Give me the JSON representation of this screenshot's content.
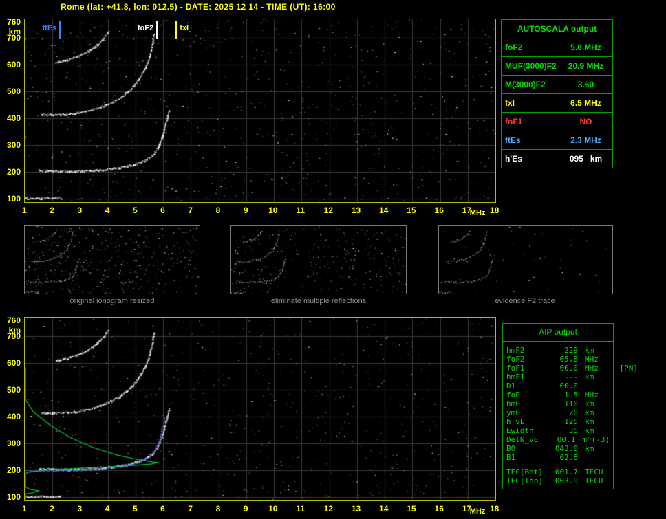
{
  "header": {
    "title": "Rome (lat: +41.8, lon: 012.5) - DATE: 2025 12 14 - TIME (UT): 16:00"
  },
  "autoscala": {
    "title": "AUTOSCALA output",
    "rows": [
      {
        "label": "foF2",
        "value": "5.8 MHz",
        "color": "#00dd00"
      },
      {
        "label": "MUF(3000)F2",
        "value": "20.9 MHz",
        "color": "#00dd00"
      },
      {
        "label": "M(3000)F2",
        "value": "3.60",
        "color": "#00dd00"
      },
      {
        "label": "fxI",
        "value": "6.5 MHz",
        "color": "#ffff00"
      },
      {
        "label": "foF1",
        "value": "NO",
        "color": "#ff3333"
      },
      {
        "label": "ftEs",
        "value": "2.3 MHz",
        "color": "#44aaff"
      },
      {
        "label": "h'Es",
        "value": "095   km",
        "color": "#ffffff"
      }
    ]
  },
  "thumbnails": [
    {
      "caption": "original ionogram resized",
      "noise_count": 520
    },
    {
      "caption": "eliminate multiple reflections",
      "noise_count": 330
    },
    {
      "caption": "evidence F2 trace",
      "noise_count": 70
    }
  ],
  "aip": {
    "title": "AIP output",
    "rows": [
      {
        "label": "hmF2",
        "value": "229",
        "unit": "km"
      },
      {
        "label": "foF2",
        "value": "05.8",
        "unit": "MHz"
      },
      {
        "label": "foF1",
        "value": "00.0",
        "unit": "MHz",
        "note": "[PN]"
      },
      {
        "label": "hmF1",
        "value": "---",
        "unit": "km"
      },
      {
        "label": "D1",
        "value": "00.0",
        "unit": ""
      },
      {
        "label": "foE",
        "value": "1.5",
        "unit": "MHz"
      },
      {
        "label": "hmE",
        "value": "110",
        "unit": "km"
      },
      {
        "label": "ymE",
        "value": "20",
        "unit": "km"
      },
      {
        "label": "h_vE",
        "value": "125",
        "unit": "km"
      },
      {
        "label": "Ewidth",
        "value": "35",
        "unit": "km"
      },
      {
        "label": "DelN_vE",
        "value": "00.1",
        "unit": "m^(-3)"
      },
      {
        "label": "B0",
        "value": "043.0",
        "unit": "km"
      },
      {
        "label": "B1",
        "value": "02.8",
        "unit": ""
      },
      {
        "label": "TEC[Bot]",
        "value": "001.7",
        "unit": "TECU"
      },
      {
        "label": "TEC[Top]",
        "value": "003.9",
        "unit": "TECU"
      }
    ]
  },
  "chart_data": [
    {
      "id": "ionogram-main",
      "type": "scatter",
      "title": "recorded ionogram with autoscaled characteristics",
      "xlabel": "MHz",
      "ylabel": "km",
      "xlim": [
        1,
        18
      ],
      "ylim": [
        100,
        760
      ],
      "xticks": [
        1,
        2,
        3,
        4,
        5,
        6,
        7,
        8,
        9,
        10,
        11,
        12,
        13,
        14,
        15,
        16,
        17,
        18
      ],
      "yticks": [
        760,
        700,
        600,
        500,
        400,
        300,
        200,
        100
      ],
      "grid": true,
      "noise_count": 1100,
      "markers": [
        {
          "label": "ftEs",
          "freq_mhz": 2.3,
          "color": "#3388ff",
          "side": "left"
        },
        {
          "label": "foF2",
          "freq_mhz": 5.8,
          "color": "#ffffff",
          "side": "left"
        },
        {
          "label": "fxI",
          "freq_mhz": 6.5,
          "color": "#ffff00",
          "side": "right"
        }
      ],
      "traces": [
        {
          "name": "F2-first-hop",
          "color": "#ffffff",
          "points": [
            [
              1.5,
              208
            ],
            [
              2.0,
              205
            ],
            [
              2.6,
              204
            ],
            [
              3.2,
              206
            ],
            [
              3.8,
              210
            ],
            [
              4.4,
              217
            ],
            [
              4.9,
              228
            ],
            [
              5.3,
              243
            ],
            [
              5.6,
              262
            ],
            [
              5.8,
              292
            ],
            [
              5.95,
              330
            ],
            [
              6.05,
              370
            ],
            [
              6.15,
              410
            ],
            [
              6.2,
              430
            ]
          ]
        },
        {
          "name": "F2-second-hop",
          "color": "#ffffff",
          "points": [
            [
              1.6,
              415
            ],
            [
              2.2,
              415
            ],
            [
              2.8,
              420
            ],
            [
              3.4,
              432
            ],
            [
              3.9,
              450
            ],
            [
              4.4,
              475
            ],
            [
              4.8,
              508
            ],
            [
              5.1,
              545
            ],
            [
              5.35,
              590
            ],
            [
              5.5,
              635
            ],
            [
              5.6,
              680
            ],
            [
              5.65,
              715
            ]
          ]
        },
        {
          "name": "F2-third-hop",
          "color": "#ffffff",
          "points": [
            [
              2.1,
              610
            ],
            [
              2.5,
              618
            ],
            [
              2.9,
              632
            ],
            [
              3.3,
              652
            ],
            [
              3.6,
              675
            ],
            [
              3.85,
              700
            ],
            [
              4.0,
              725
            ]
          ]
        },
        {
          "name": "Es-layer",
          "color": "#ffffff",
          "points": [
            [
              1.0,
              103
            ],
            [
              1.5,
              104
            ],
            [
              2.0,
              104
            ],
            [
              2.3,
              105
            ]
          ]
        }
      ]
    },
    {
      "id": "ionogram-profile",
      "type": "scatter",
      "title": "ionogram with restored trace and electron density profile",
      "xlabel": "MHz",
      "ylabel": "km",
      "xlim": [
        1,
        18
      ],
      "ylim": [
        100,
        760
      ],
      "xticks": [
        1,
        2,
        3,
        4,
        5,
        6,
        7,
        8,
        9,
        10,
        11,
        12,
        13,
        14,
        15,
        16,
        17,
        18
      ],
      "yticks": [
        760,
        700,
        600,
        500,
        400,
        300,
        200,
        100
      ],
      "grid": true,
      "noise_count": 850,
      "traces": [
        {
          "name": "F2-first-hop",
          "color": "#ffffff",
          "points": [
            [
              1.5,
              208
            ],
            [
              2.0,
              205
            ],
            [
              2.6,
              204
            ],
            [
              3.2,
              206
            ],
            [
              3.8,
              210
            ],
            [
              4.4,
              217
            ],
            [
              4.9,
              228
            ],
            [
              5.3,
              243
            ],
            [
              5.6,
              262
            ],
            [
              5.8,
              292
            ],
            [
              5.95,
              330
            ],
            [
              6.05,
              370
            ],
            [
              6.15,
              410
            ],
            [
              6.2,
              430
            ]
          ]
        },
        {
          "name": "F2-second-hop",
          "color": "#ffffff",
          "points": [
            [
              1.6,
              415
            ],
            [
              2.2,
              415
            ],
            [
              2.8,
              420
            ],
            [
              3.4,
              432
            ],
            [
              3.9,
              450
            ],
            [
              4.4,
              475
            ],
            [
              4.8,
              508
            ],
            [
              5.1,
              545
            ],
            [
              5.35,
              590
            ],
            [
              5.5,
              635
            ],
            [
              5.6,
              680
            ],
            [
              5.65,
              715
            ]
          ]
        },
        {
          "name": "F2-third-hop",
          "color": "#ffffff",
          "points": [
            [
              2.1,
              610
            ],
            [
              2.5,
              618
            ],
            [
              2.9,
              632
            ],
            [
              3.3,
              652
            ],
            [
              3.6,
              675
            ],
            [
              3.85,
              700
            ],
            [
              4.0,
              725
            ]
          ]
        },
        {
          "name": "Es-layer",
          "color": "#ffffff",
          "points": [
            [
              1.0,
              103
            ],
            [
              1.5,
              104
            ],
            [
              2.0,
              104
            ],
            [
              2.3,
              105
            ]
          ]
        }
      ],
      "profile": {
        "name": "electron-density-profile",
        "color": "#00cc44",
        "points": [
          [
            0.15,
            585
          ],
          [
            0.5,
            520
          ],
          [
            0.9,
            465
          ],
          [
            1.3,
            420
          ],
          [
            1.9,
            370
          ],
          [
            2.6,
            325
          ],
          [
            3.4,
            288
          ],
          [
            4.3,
            258
          ],
          [
            5.1,
            240
          ],
          [
            5.6,
            232
          ],
          [
            5.8,
            229
          ],
          [
            5.6,
            224
          ],
          [
            5.0,
            219
          ],
          [
            4.0,
            213
          ],
          [
            3.0,
            208
          ],
          [
            2.2,
            204
          ],
          [
            1.6,
            199
          ],
          [
            1.1,
            193
          ],
          [
            0.8,
            186
          ],
          [
            0.6,
            176
          ],
          [
            0.5,
            164
          ],
          [
            0.55,
            150
          ],
          [
            0.8,
            138
          ],
          [
            1.2,
            129
          ],
          [
            1.5,
            124
          ],
          [
            1.3,
            117
          ],
          [
            0.9,
            112
          ],
          [
            0.5,
            107
          ],
          [
            0.25,
            100
          ],
          [
            0.15,
            94
          ]
        ]
      },
      "restored_trace": {
        "name": "autoscaled-F2-trace",
        "color": "#4466ff",
        "points": [
          [
            1.0,
            199
          ],
          [
            1.5,
            200
          ],
          [
            2.2,
            200
          ],
          [
            3.0,
            202
          ],
          [
            3.8,
            207
          ],
          [
            4.5,
            215
          ],
          [
            5.0,
            227
          ],
          [
            5.4,
            245
          ],
          [
            5.7,
            275
          ],
          [
            5.85,
            315
          ],
          [
            5.95,
            355
          ],
          [
            6.05,
            395
          ]
        ]
      }
    }
  ]
}
